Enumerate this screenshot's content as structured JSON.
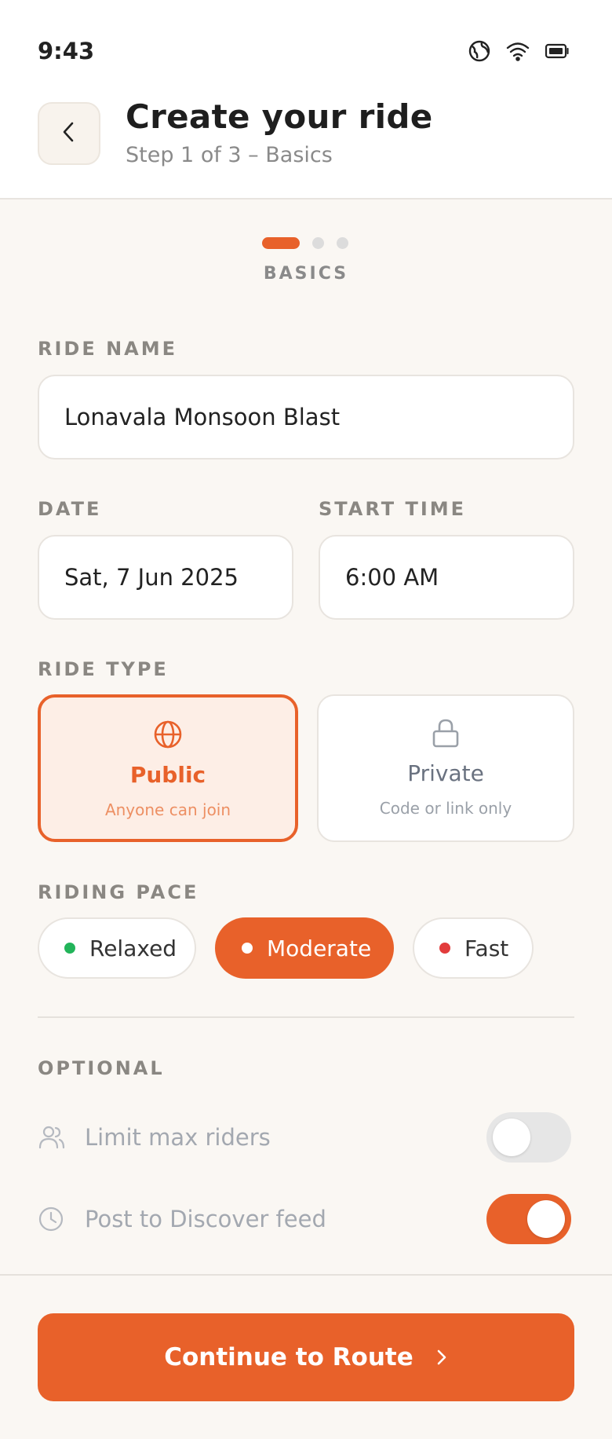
{
  "status_bar": {
    "time": "9:43",
    "icons": [
      "globe-icon",
      "wifi-icon",
      "battery-icon"
    ]
  },
  "header": {
    "back_icon": "chevron-left-icon",
    "title": "Create your ride",
    "subtitle": "Step 1 of 3 – Basics"
  },
  "progress": {
    "current_step": 1,
    "total_steps": 3,
    "step_label": "BASICS"
  },
  "ride_name": {
    "label": "RIDE NAME",
    "value": "Lonavala Monsoon Blast"
  },
  "date": {
    "label": "DATE",
    "value": "Sat, 7 Jun 2025"
  },
  "start_time": {
    "label": "START TIME",
    "value": "6:00 AM"
  },
  "ride_type": {
    "label": "RIDE TYPE",
    "options": [
      {
        "name": "Public",
        "description": "Anyone can join",
        "icon": "globe-icon",
        "selected": true
      },
      {
        "name": "Private",
        "description": "Code or link only",
        "icon": "lock-icon",
        "selected": false
      }
    ]
  },
  "riding_pace": {
    "label": "RIDING PACE",
    "options": [
      {
        "name": "Relaxed",
        "dot_color": "#22b45a",
        "selected": false
      },
      {
        "name": "Moderate",
        "dot_color": "#ffffff",
        "selected": true
      },
      {
        "name": "Fast",
        "dot_color": "#e23b3b",
        "selected": false
      }
    ]
  },
  "optional": {
    "label": "OPTIONAL",
    "items": [
      {
        "label": "Limit max riders",
        "icon": "users-icon",
        "enabled": false
      },
      {
        "label": "Post to Discover feed",
        "icon": "clock-icon",
        "enabled": true
      }
    ]
  },
  "cta": {
    "label": "Continue to Route",
    "icon": "chevron-right-icon"
  },
  "colors": {
    "accent": "#e8612a",
    "background": "#faf7f3",
    "accent_light": "#fdeee6"
  }
}
